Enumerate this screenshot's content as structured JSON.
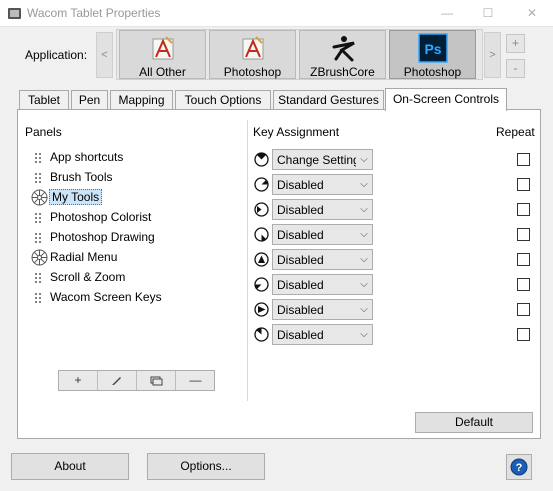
{
  "window": {
    "title": "Wacom Tablet Properties",
    "icon": "wacom-tablet-icon",
    "minimize_glyph": "—",
    "maximize_glyph": "☐",
    "close_glyph": "✕"
  },
  "application": {
    "label": "Application:",
    "prev_glyph": "<",
    "next_glyph": ">",
    "add_glyph": "+",
    "remove_glyph": "-",
    "apps": [
      {
        "label": "All Other",
        "icon": "all-other-app-icon",
        "selected": false
      },
      {
        "label": "Photoshop",
        "icon": "photoshop-generic-icon",
        "selected": false
      },
      {
        "label": "ZBrushCore",
        "icon": "zbrushcore-icon",
        "selected": false
      },
      {
        "label": "Photoshop",
        "icon": "photoshop-ps-icon",
        "selected": true
      }
    ]
  },
  "tabs": [
    {
      "label": "Tablet",
      "active": false
    },
    {
      "label": "Pen",
      "active": false
    },
    {
      "label": "Mapping",
      "active": false
    },
    {
      "label": "Touch Options",
      "active": false
    },
    {
      "label": "Standard Gestures",
      "active": false
    },
    {
      "label": "On-Screen Controls",
      "active": true
    }
  ],
  "panels": {
    "heading": "Panels",
    "items": [
      {
        "label": "App shortcuts",
        "icon": "grip-icon",
        "selected": false
      },
      {
        "label": "Brush Tools",
        "icon": "grip-icon",
        "selected": false
      },
      {
        "label": "My Tools",
        "icon": "radial-menu-icon",
        "selected": true
      },
      {
        "label": "Photoshop Colorist",
        "icon": "grip-icon",
        "selected": false
      },
      {
        "label": "Photoshop Drawing",
        "icon": "grip-icon",
        "selected": false
      },
      {
        "label": "Radial Menu",
        "icon": "radial-menu-icon",
        "selected": false
      },
      {
        "label": "Scroll & Zoom",
        "icon": "grip-icon",
        "selected": false
      },
      {
        "label": "Wacom Screen Keys",
        "icon": "grip-icon",
        "selected": false
      }
    ],
    "toolbar": {
      "add_glyph": "+",
      "edit_icon": "pencil-icon",
      "duplicate_icon": "duplicate-icon",
      "remove_glyph": "—"
    }
  },
  "keys": {
    "heading": "Key Assignment",
    "repeat_heading": "Repeat",
    "rows": [
      {
        "value": "Change Setting",
        "repeat": false
      },
      {
        "value": "Disabled",
        "repeat": false
      },
      {
        "value": "Disabled",
        "repeat": false
      },
      {
        "value": "Disabled",
        "repeat": false
      },
      {
        "value": "Disabled",
        "repeat": false
      },
      {
        "value": "Disabled",
        "repeat": false
      },
      {
        "value": "Disabled",
        "repeat": false
      },
      {
        "value": "Disabled",
        "repeat": false
      }
    ],
    "dropdown_glyph": "⌵"
  },
  "buttons": {
    "default": "Default",
    "about": "About",
    "options": "Options...",
    "help_icon": "help-icon"
  },
  "colors": {
    "selection_fill": "#cce4f7",
    "photoshop_bg": "#001e36",
    "photoshop_fg": "#31a8ff",
    "help_blue": "#1a5fb4"
  }
}
